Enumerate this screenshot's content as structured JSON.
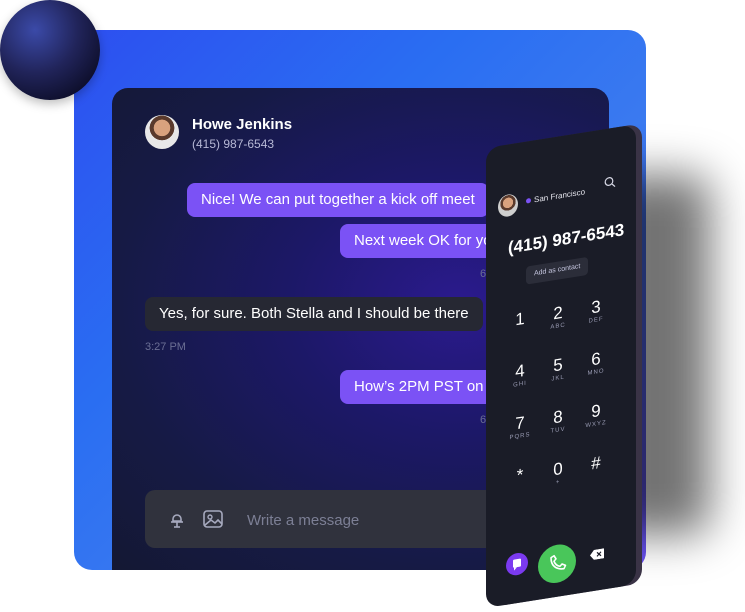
{
  "contact": {
    "name": "Howe Jenkins",
    "phone": "(415) 987-6543"
  },
  "messages": [
    {
      "text": "Nice! We can put together a kick off meet",
      "from": "me"
    },
    {
      "text": "Next week OK for yo",
      "from": "me",
      "time": "6:4"
    },
    {
      "text": "Yes, for sure. Both Stella and I should be there",
      "from": "them",
      "time": "3:27 PM"
    },
    {
      "text": "How’s 2PM PST on T",
      "from": "me",
      "time": "6:"
    }
  ],
  "composer": {
    "placeholder": "Write a message"
  },
  "dialer": {
    "location": "San Francisco",
    "number": "(415) 987-6543",
    "add_contact": "Add as contact",
    "keys": [
      {
        "d": "1",
        "l": ""
      },
      {
        "d": "2",
        "l": "ABC"
      },
      {
        "d": "3",
        "l": "DEF"
      },
      {
        "d": "4",
        "l": "GHI"
      },
      {
        "d": "5",
        "l": "JKL"
      },
      {
        "d": "6",
        "l": "MNO"
      },
      {
        "d": "7",
        "l": "PQRS"
      },
      {
        "d": "8",
        "l": "TUV"
      },
      {
        "d": "9",
        "l": "WXYZ"
      },
      {
        "d": "*",
        "l": ""
      },
      {
        "d": "0",
        "l": "+"
      },
      {
        "d": "#",
        "l": ""
      }
    ]
  },
  "colors": {
    "accent": "#7b52f5",
    "call": "#49c65a",
    "card_gradient_start": "#2d4ff0"
  }
}
